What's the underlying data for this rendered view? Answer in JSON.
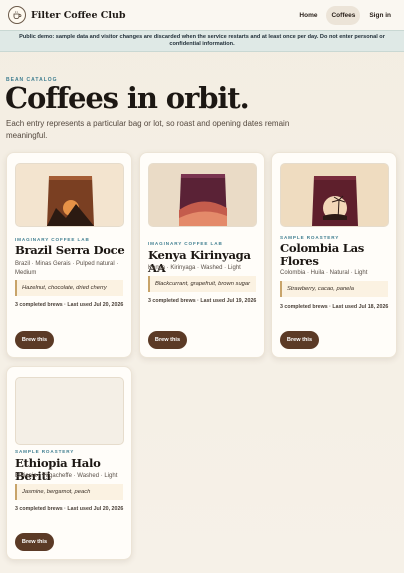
{
  "header": {
    "brand": "Filter Coffee Club",
    "nav": [
      {
        "label": "Home",
        "active": false
      },
      {
        "label": "Coffees",
        "active": true
      },
      {
        "label": "Sign in",
        "active": false
      }
    ]
  },
  "banner": {
    "text": "Public demo: sample data and visitor changes are discarded when the service restarts and at least once per day. Do not enter personal or confidential information."
  },
  "hero": {
    "eyebrow": "BEAN CATALOG",
    "title": "Coffees in orbit.",
    "subtitle": "Each entry represents a particular bag or lot, so roast and opening dates remain meaningful."
  },
  "cards": [
    {
      "roaster": "IMAGINARY COFFEE LAB",
      "name": "Brazil Serra Doce",
      "meta": "Brazil · Minas Gerais · Pulped natural · Medium",
      "notes": "Hazelnut, chocolate, dried cherry",
      "stats": "3 completed brews  ·  Last used Jul 20, 2026",
      "button": "Brew this",
      "image": "bag-brazil"
    },
    {
      "roaster": "IMAGINARY COFFEE LAB",
      "name": "Kenya Kirinyaga AA",
      "meta": "Kenya · Kirinyaga · Washed · Light",
      "notes": "Blackcurrant, grapefruit, brown sugar",
      "stats": "3 completed brews  ·  Last used Jul 19, 2026",
      "button": "Brew this",
      "image": "bag-kenya"
    },
    {
      "roaster": "SAMPLE ROASTERY",
      "name": "Colombia Las Flores",
      "meta": "Colombia · Huila · Natural · Light",
      "notes": "Strawberry, cacao, panela",
      "stats": "3 completed brews  ·  Last used Jul 18, 2026",
      "button": "Brew this",
      "image": "bag-colombia"
    },
    {
      "roaster": "SAMPLE ROASTERY",
      "name": "Ethiopia Halo Beriti",
      "meta": "Ethiopia · Yirgacheffe · Washed · Light",
      "notes": "Jasmine, bergamot, peach",
      "stats": "3 completed brews  ·  Last used Jul 20, 2026",
      "button": "Brew this",
      "image": ""
    }
  ],
  "colors": {
    "accent": "#3f7e90",
    "button": "#5b3a26",
    "notes_bg": "#fbf2e2",
    "banner_bg": "#dfe9e6"
  }
}
